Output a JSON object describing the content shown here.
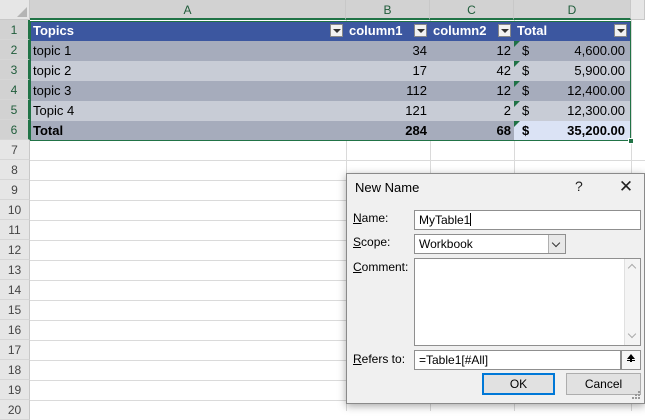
{
  "sheet": {
    "columns": [
      "A",
      "B",
      "C",
      "D"
    ],
    "rows": [
      "1",
      "2",
      "3",
      "4",
      "5",
      "6",
      "7",
      "8",
      "9",
      "10",
      "11",
      "12",
      "13",
      "14",
      "15",
      "16",
      "17",
      "18",
      "19",
      "20"
    ]
  },
  "table": {
    "headers": [
      "Topics",
      "column1",
      "column2",
      "Total"
    ],
    "body": [
      {
        "topic": "topic 1",
        "c1": "34",
        "c2": "12",
        "currency": "$",
        "total": "4,600.00"
      },
      {
        "topic": "topic 2",
        "c1": "17",
        "c2": "42",
        "currency": "$",
        "total": "5,900.00"
      },
      {
        "topic": "topic 3",
        "c1": "112",
        "c2": "12",
        "currency": "$",
        "total": "12,400.00"
      },
      {
        "topic": "Topic 4",
        "c1": "121",
        "c2": "2",
        "currency": "$",
        "total": "12,300.00"
      }
    ],
    "total_row": {
      "topic": "Total",
      "c1": "284",
      "c2": "68",
      "currency": "$",
      "total": "35,200.00"
    }
  },
  "dialog": {
    "title": "New Name",
    "help_glyph": "?",
    "close_glyph": "✕",
    "name_label_u": "N",
    "name_label_rest": "ame:",
    "name_value": "MyTable1",
    "scope_label_u": "S",
    "scope_label_rest": "cope:",
    "scope_value": "Workbook",
    "comment_label_u": "C",
    "comment_label_rest": "omment:",
    "comment_value": "",
    "refers_label_u": "R",
    "refers_label_rest": "efers to:",
    "refers_value": "=Table1[#All]",
    "ok_label": "OK",
    "cancel_label": "Cancel"
  },
  "colors": {
    "header_blue": "#3c57a0",
    "band_dark": "#a6acbc",
    "band_light": "#c8ccd6",
    "excel_green": "#217346",
    "focus_blue": "#0078d7"
  }
}
